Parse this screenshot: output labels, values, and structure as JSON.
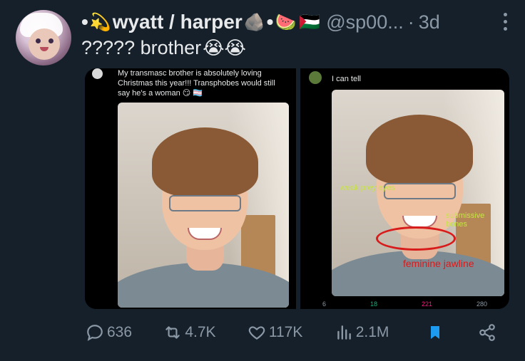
{
  "tweet": {
    "display_name": "wyatt / harper",
    "name_prefix": "•",
    "name_emoji_1": "💫",
    "name_emoji_2": "🪨",
    "name_sep": "•",
    "name_emoji_3": "🍉",
    "name_emoji_4": "🇵🇸",
    "handle": "@sp00...",
    "time_sep": "·",
    "time": "3d",
    "text": "????? brother",
    "text_emojis": "😭😭"
  },
  "media": {
    "left_caption_top": "My transmasc brother is absolutely loving",
    "left_caption_mid": "Christmas this year!!! Transphobes would still",
    "left_caption_bot": "say he's a woman 😏 🏳️‍⚧️",
    "right_caption": "I can tell",
    "annotation_eyes": "weak prey eyes",
    "annotation_bones": "submissive bones",
    "annotation_jaw": "feminine jawline",
    "right_stats": {
      "replies": "6",
      "retweets": "18",
      "likes": "221",
      "views": "280"
    }
  },
  "actions": {
    "replies": "636",
    "reposts": "4.7K",
    "likes": "117K",
    "views": "2.1M"
  },
  "colors": {
    "background": "#15202b",
    "muted": "#8b98a5",
    "bookmark_active": "#1d9bf0",
    "annotation_green": "#c8e34a",
    "annotation_red": "#d81b1b"
  },
  "icons": {
    "reply": "reply-icon",
    "repost": "repost-icon",
    "like": "heart-icon",
    "views": "bar-chart-icon",
    "bookmark": "bookmark-icon",
    "share": "share-icon",
    "more": "more-icon"
  }
}
